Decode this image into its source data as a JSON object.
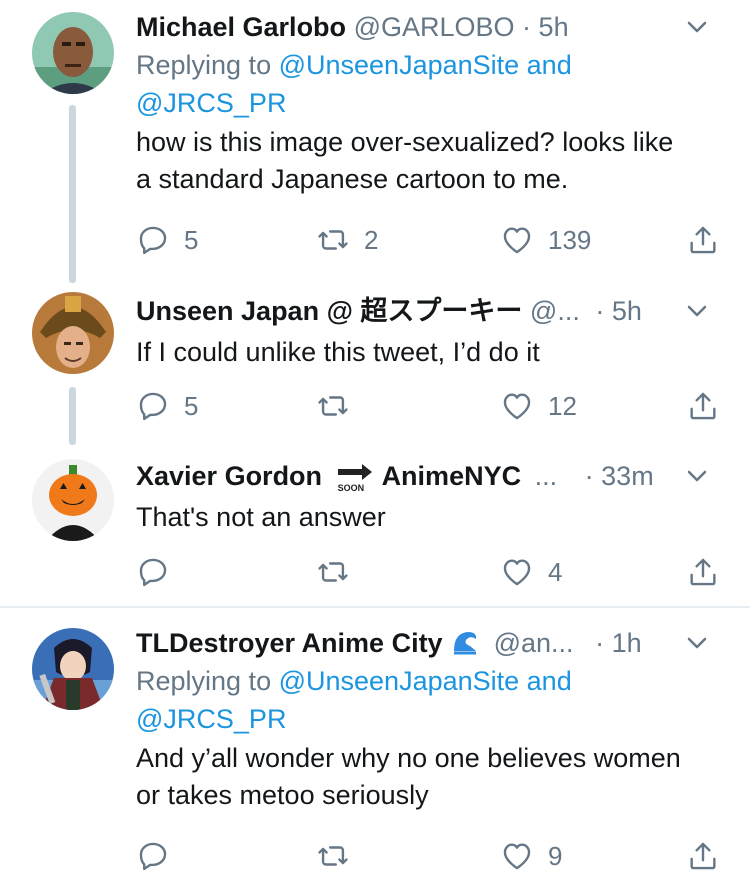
{
  "tweets": [
    {
      "name": "Michael Garlobo",
      "handle": "@GARLOBO",
      "dot": "·",
      "time": "5h",
      "replying_prefix": "Replying to ",
      "replying_links": "@UnseenJapanSite and",
      "replying_links2": "@JRCS_PR",
      "text_line1": "how is this image over-sexualized? looks like",
      "text_line2": "a standard Japanese cartoon to me.",
      "replies": "5",
      "retweets": "2",
      "likes": "139"
    },
    {
      "name": "Unseen Japan @ 超スプーキー",
      "handle": "@...",
      "dot": "·",
      "time": "5h",
      "text_line1": "If I could unlike this tweet, I’d do it",
      "replies": "5",
      "retweets": "",
      "likes": "12"
    },
    {
      "name_part1": "Xavier Gordon",
      "soon_label": "SOON",
      "name_part2": "AnimeNYC",
      "handle": "...",
      "dot": "·",
      "time": "33m",
      "text_line1": "That's not an answer",
      "replies": "",
      "retweets": "",
      "likes": "4"
    },
    {
      "name": "TLDestroyer Anime City",
      "handle": "@an...",
      "dot": "·",
      "time": "1h",
      "replying_prefix": "Replying to ",
      "replying_links": "@UnseenJapanSite and",
      "replying_links2": "@JRCS_PR",
      "text_line1": "And y’all wonder why no one believes women",
      "text_line2": "or takes metoo seriously",
      "replies": "",
      "retweets": "",
      "likes": "9"
    }
  ],
  "colors": {
    "text": "#14171a",
    "muted": "#657786",
    "link": "#1b95e0",
    "thread_line": "#ccd6dd",
    "separator": "#e6ecf0"
  },
  "icons": [
    "reply-icon",
    "retweet-icon",
    "like-icon",
    "share-icon",
    "chevron-down-icon",
    "wave-emoji-icon",
    "soon-arrow-icon"
  ]
}
